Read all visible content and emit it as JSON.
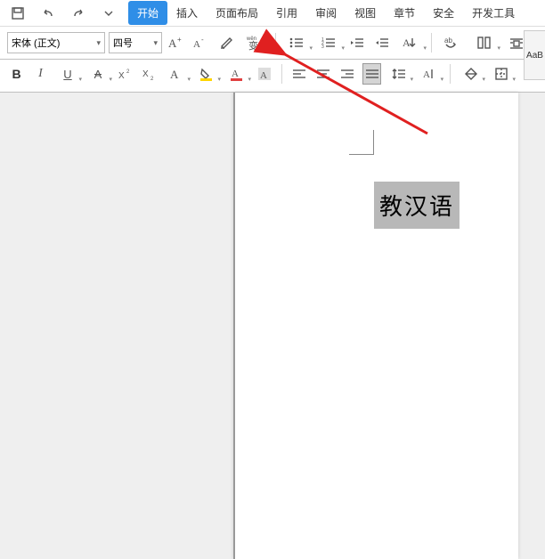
{
  "menubar": {
    "tabs": [
      "开始",
      "插入",
      "页面布局",
      "引用",
      "审阅",
      "视图",
      "章节",
      "安全",
      "开发工具"
    ],
    "active_index": 0
  },
  "ribbon": {
    "font_name": "宋体 (正文)",
    "font_size": "四号",
    "phonetic_label": "wěn",
    "phonetic_char": "变"
  },
  "style_panel": {
    "label": "AaB"
  },
  "document": {
    "selected_text": "教汉语"
  },
  "annotation": {
    "color": "#E02020"
  }
}
